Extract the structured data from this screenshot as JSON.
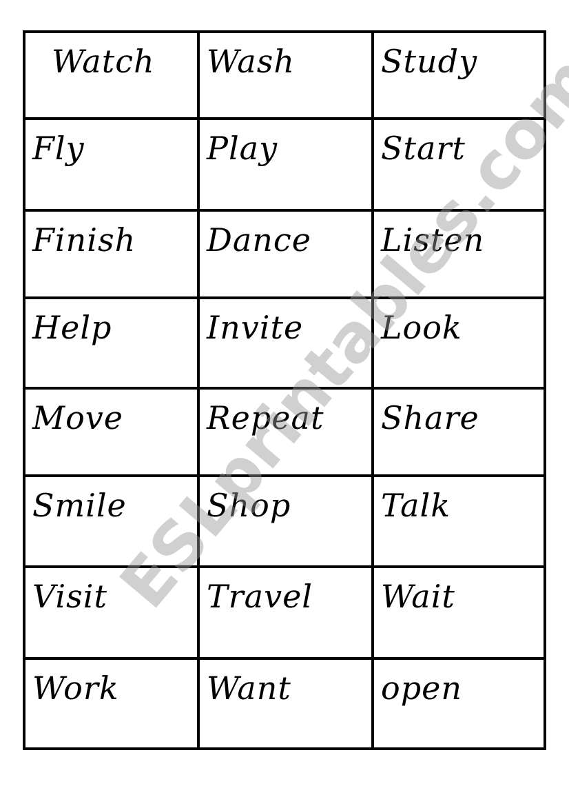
{
  "words": [
    [
      "Watch",
      "Wash",
      "Study"
    ],
    [
      "Fly",
      "Play",
      "Start"
    ],
    [
      "Finish",
      "Dance",
      "Listen"
    ],
    [
      "Help",
      "Invite",
      "Look"
    ],
    [
      "Move",
      "Repeat",
      "Share"
    ],
    [
      "Smile",
      "Shop",
      "Talk"
    ],
    [
      "Visit",
      "Travel",
      "Wait"
    ],
    [
      "Work",
      "Want",
      "open"
    ]
  ],
  "watermark": "ESLprintables.com"
}
